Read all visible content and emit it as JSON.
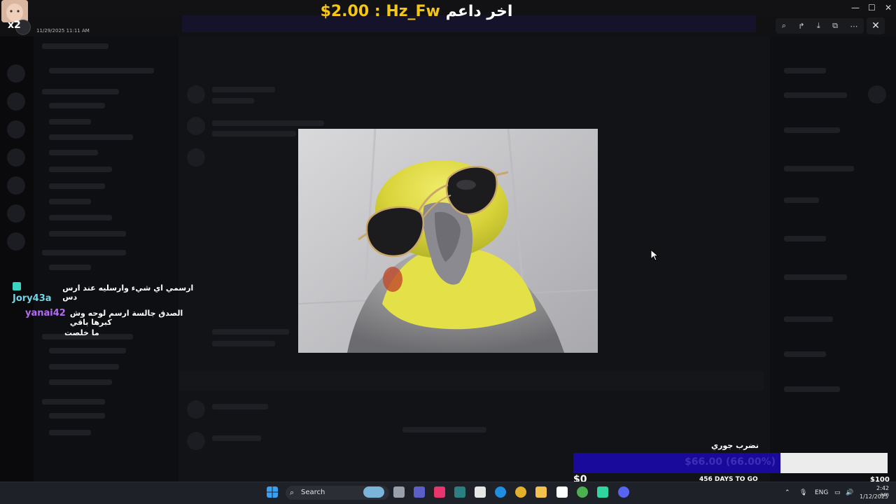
{
  "donation": {
    "amount": "$2.00",
    "separator": ":",
    "donor": "Hz_Fw",
    "label": "اخر داعم"
  },
  "overlay": {
    "multiplier": "x2",
    "datetime": "11/29/2025 11:11 AM"
  },
  "viewer": {
    "tools": [
      "zoom-icon",
      "share-icon",
      "download-icon",
      "open-external-icon",
      "more-icon"
    ],
    "close_icon": "close-icon"
  },
  "chat": {
    "messages": [
      {
        "user": "Jory43a",
        "text": "ارسمي اي شيء وارسليه عند ارس دس",
        "has_badge": true
      },
      {
        "user": "yanai42",
        "text": "الصدق جالسة ارسم لوحه وش كبرها باقي",
        "continuation": "ما خلصت",
        "has_badge": false
      }
    ]
  },
  "goal": {
    "title": "نضرب جوري",
    "current_text": "$66.00 (66.00%)",
    "progress_fraction": 0.66,
    "min_label": "$0",
    "max_label": "$100",
    "days_label": "456 DAYS TO GO"
  },
  "taskbar": {
    "search_label": "Search",
    "language": "ENG",
    "time": "2:42 am",
    "date": "1/12/2025"
  },
  "colors": {
    "donation_yellow": "#f6c615",
    "goal_fill": "#1a0a9c",
    "goal_track": "#ececec"
  }
}
